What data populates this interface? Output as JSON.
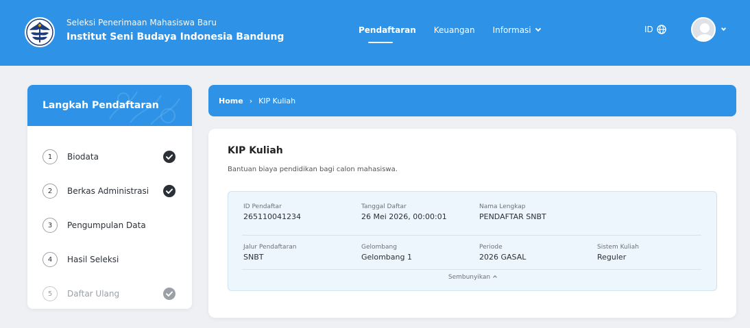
{
  "header": {
    "subtitle": "Seleksi Penerimaan Mahasiswa Baru",
    "title": "Institut Seni Budaya Indonesia Bandung",
    "nav": [
      {
        "label": "Pendaftaran",
        "active": true
      },
      {
        "label": "Keuangan",
        "active": false
      },
      {
        "label": "Informasi",
        "active": false
      }
    ],
    "lang": "ID"
  },
  "sidebar": {
    "title": "Langkah Pendaftaran",
    "steps": [
      {
        "num": "1",
        "label": "Biodata",
        "done": true
      },
      {
        "num": "2",
        "label": "Berkas Administrasi",
        "done": true
      },
      {
        "num": "3",
        "label": "Pengumpulan Data",
        "done": false
      },
      {
        "num": "4",
        "label": "Hasil Seleksi",
        "done": false
      },
      {
        "num": "5",
        "label": "Daftar Ulang",
        "done": true,
        "muted": true
      }
    ]
  },
  "breadcrumb": {
    "home": "Home",
    "separator": "›",
    "current": "KIP Kuliah"
  },
  "main": {
    "title": "KIP Kuliah",
    "description": "Bantuan biaya pendidikan bagi calon mahasiswa.",
    "info": {
      "id_pendaftar": {
        "label": "ID Pendaftar",
        "value": "265110041234"
      },
      "tanggal_daftar": {
        "label": "Tanggal Daftar",
        "value": "26 Mei 2026, 00:00:01"
      },
      "nama_lengkap": {
        "label": "Nama Lengkap",
        "value": "PENDAFTAR SNBT"
      },
      "jalur": {
        "label": "Jalur Pendaftaran",
        "value": "SNBT"
      },
      "gelombang": {
        "label": "Gelombang",
        "value": "Gelombang 1"
      },
      "periode": {
        "label": "Periode",
        "value": "2026 GASAL"
      },
      "sistem": {
        "label": "Sistem Kuliah",
        "value": "Reguler"
      }
    },
    "toggle_label": "Sembunyikan"
  },
  "colors": {
    "primary": "#2e93e6",
    "check_dark": "#2b2f36",
    "check_muted": "#9aa0a6"
  }
}
